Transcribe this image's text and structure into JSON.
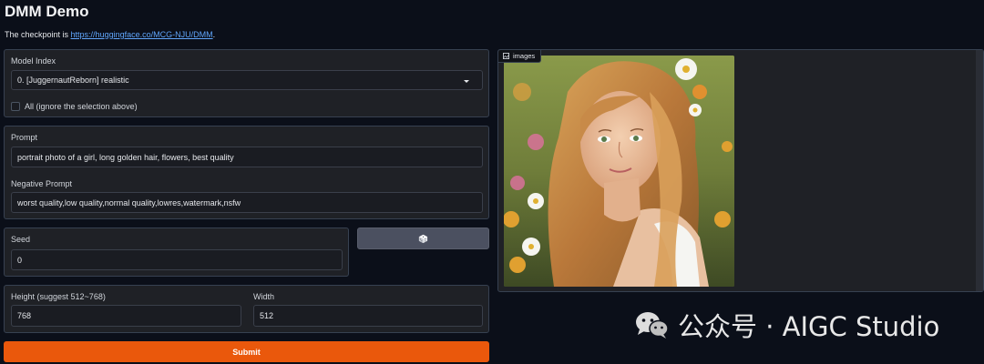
{
  "header": {
    "title": "DMM Demo",
    "subtitle_prefix": "The checkpoint is ",
    "subtitle_link": "https://huggingface.co/MCG-NJU/DMM",
    "subtitle_suffix": "."
  },
  "model": {
    "label": "Model Index",
    "selected": "0. [JuggernautReborn] realistic",
    "all_checkbox_label": "All (ignore the selection above)",
    "all_checked": false
  },
  "prompt": {
    "label": "Prompt",
    "value": "portrait photo of a girl, long golden hair, flowers, best quality",
    "negative_label": "Negative Prompt",
    "negative_value": "worst quality,low quality,normal quality,lowres,watermark,nsfw"
  },
  "seed": {
    "label": "Seed",
    "value": "0",
    "randomize_icon": "dice-icon"
  },
  "size": {
    "height_label": "Height (suggest 512~768)",
    "height_value": "768",
    "width_label": "Width",
    "width_value": "512"
  },
  "submit_label": "Submit",
  "gallery": {
    "tag": "images",
    "tag_icon": "image-icon"
  },
  "watermark": {
    "text": "公众号 · AIGC Studio",
    "icon": "wechat-icon"
  },
  "colors": {
    "accent": "#ea580c",
    "link": "#60a5fa",
    "background": "#0b0f19"
  }
}
